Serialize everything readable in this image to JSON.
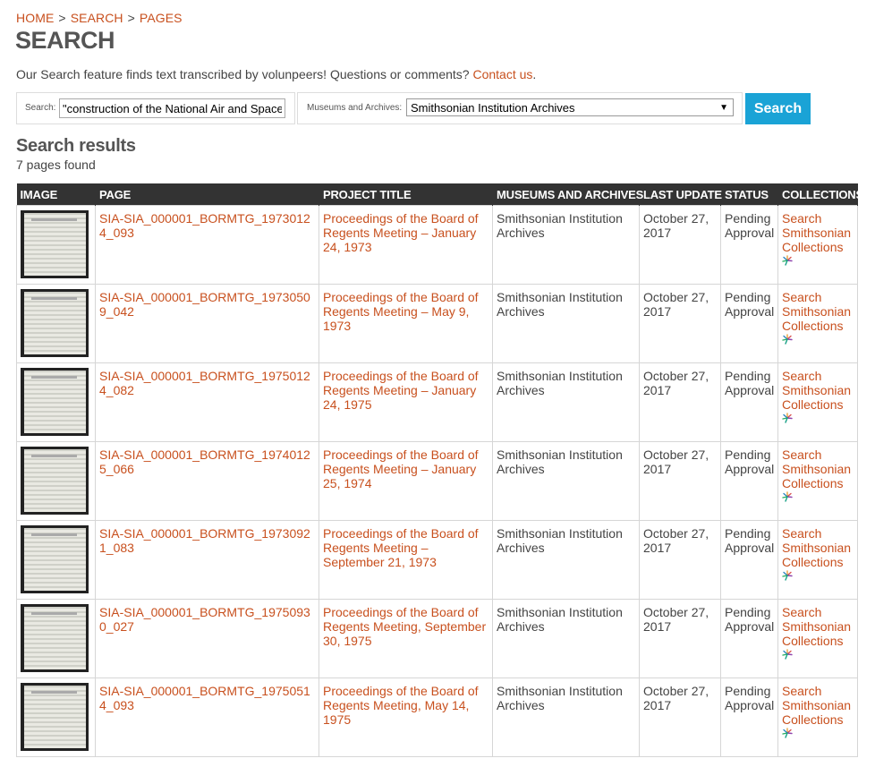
{
  "breadcrumb": {
    "home": "HOME",
    "search": "SEARCH",
    "pages": "PAGES",
    "separator": ">"
  },
  "page_title": "SEARCH",
  "intro": {
    "text": "Our Search feature finds text transcribed by volunpeers! Questions or comments? ",
    "link": "Contact us",
    "suffix": "."
  },
  "search": {
    "label": "Search:",
    "value": "\"construction of the National Air and Space",
    "museum_label": "Museums and Archives:",
    "museum_value": "Smithsonian Institution Archives",
    "button_label": "Search"
  },
  "results": {
    "title": "Search results",
    "count": "7 pages found",
    "columns": [
      "IMAGE",
      "PAGE",
      "PROJECT TITLE",
      "MUSEUMS AND ARCHIVES",
      "LAST UPDATE",
      "STATUS",
      "COLLECTIONS"
    ],
    "rows": [
      {
        "page": "SIA-SIA_000001_BORMTG_19730124_093",
        "title": "Proceedings of the Board of Regents Meeting – January 24, 1973",
        "museum": "Smithsonian Institution Archives",
        "updated": "October 27, 2017",
        "status": "Pending Approval",
        "collection": "Search Smithsonian Collections"
      },
      {
        "page": "SIA-SIA_000001_BORMTG_19730509_042",
        "title": "Proceedings of the Board of Regents Meeting – May 9, 1973",
        "museum": "Smithsonian Institution Archives",
        "updated": "October 27, 2017",
        "status": "Pending Approval",
        "collection": "Search Smithsonian Collections"
      },
      {
        "page": "SIA-SIA_000001_BORMTG_19750124_082",
        "title": "Proceedings of the Board of Regents Meeting – January 24, 1975",
        "museum": "Smithsonian Institution Archives",
        "updated": "October 27, 2017",
        "status": "Pending Approval",
        "collection": "Search Smithsonian Collections"
      },
      {
        "page": "SIA-SIA_000001_BORMTG_19740125_066",
        "title": "Proceedings of the Board of Regents Meeting – January 25, 1974",
        "museum": "Smithsonian Institution Archives",
        "updated": "October 27, 2017",
        "status": "Pending Approval",
        "collection": "Search Smithsonian Collections"
      },
      {
        "page": "SIA-SIA_000001_BORMTG_19730921_083",
        "title": "Proceedings of the Board of Regents Meeting – September 21, 1973",
        "museum": "Smithsonian Institution Archives",
        "updated": "October 27, 2017",
        "status": "Pending Approval",
        "collection": "Search Smithsonian Collections"
      },
      {
        "page": "SIA-SIA_000001_BORMTG_19750930_027",
        "title": "Proceedings of the Board of Regents Meeting, September 30, 1975",
        "museum": "Smithsonian Institution Archives",
        "updated": "October 27, 2017",
        "status": "Pending Approval",
        "collection": "Search Smithsonian Collections"
      },
      {
        "page": "SIA-SIA_000001_BORMTG_19750514_093",
        "title": "Proceedings of the Board of Regents Meeting, May 14, 1975",
        "museum": "Smithsonian Institution Archives",
        "updated": "October 27, 2017",
        "status": "Pending Approval",
        "collection": "Search Smithsonian Collections"
      }
    ]
  },
  "colors": {
    "accent": "#c8501e",
    "button": "#1aa3d6",
    "header": "#333333"
  },
  "icons": {
    "collection": "smithsonian-sunburst-icon",
    "dropdown": "chevron-down-icon"
  }
}
